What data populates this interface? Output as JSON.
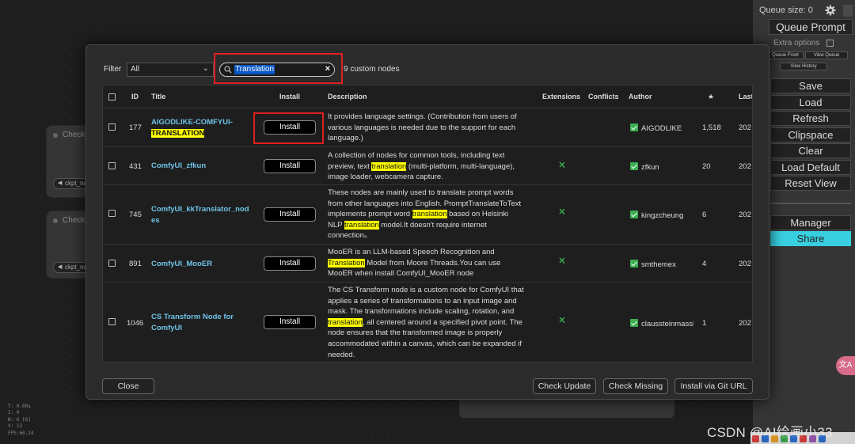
{
  "background": {
    "nodes": [
      {
        "title": "Checkp",
        "widget": "ckpt_na"
      },
      {
        "title": "Check",
        "widget": "ckpt_na"
      }
    ],
    "stats": [
      "T: 0.00s",
      "I: 0",
      "N: 6 [6]",
      "V: 12",
      "FPS:60.24"
    ]
  },
  "side_menu": {
    "queue_size": "Queue size: 0",
    "queue_prompt": "Queue Prompt",
    "extra_options": "Extra options",
    "queue_front": "Queue Front",
    "view_queue": "View Queue",
    "view_history": "View History",
    "buttons": [
      "Save",
      "Load",
      "Refresh",
      "Clipspace",
      "Clear",
      "Load Default",
      "Reset View"
    ],
    "manager": "Manager",
    "share": "Share",
    "share_color": "#38d0e0",
    "translate_bubble": "文A"
  },
  "dialog": {
    "filter_label": "Filter",
    "filter_value": "All",
    "search_value": "Translation",
    "result_count": "9 custom nodes",
    "columns": {
      "id": "ID",
      "title": "Title",
      "install": "Install",
      "description": "Description",
      "extensions": "Extensions",
      "conflicts": "Conflicts",
      "author": "Author",
      "stars": "★",
      "last": "Last"
    },
    "install_label": "Install",
    "rows": [
      {
        "id": "177",
        "title_a": "AIGODLIKE-COMFYUI-",
        "title_b": "TRANSLATION",
        "desc": [
          "It provides language settings. (Contribution from users of",
          "various languages is needed due to the support for each",
          "language.)"
        ],
        "author": "AIGODLIKE",
        "stars": "1,518",
        "last": "202"
      },
      {
        "id": "431",
        "title": "ComfyUI_zfkun",
        "desc_1": "A collection of nodes for common tools, including text",
        "desc_2a": "preview, text ",
        "desc_2hl": "translation",
        "desc_2b": " (multi-platform, multi-language),",
        "desc_3": "image loader, webcamera capture.",
        "author": "zfkun",
        "stars": "20",
        "last": "202"
      },
      {
        "id": "745",
        "title_a": "ComfyUI_kkTranslator_nod",
        "title_b": "es",
        "desc_1": "These nodes are mainly used to translate prompt words",
        "desc_2": "from other languages into English. PromptTranslateToText",
        "desc_3a": "implements prompt word ",
        "desc_3hl": "translation",
        "desc_3b": " based on Helsinki",
        "desc_4a": "NLP ",
        "desc_4hl": "translation",
        "desc_4b": " model.It doesn't require internet",
        "desc_5": "connection。",
        "author": "kingzcheung",
        "stars": "6",
        "last": "202"
      },
      {
        "id": "891",
        "title": "ComfyUI_MooER",
        "desc_1": "MooER is an LLM-based Speech Recognition and",
        "desc_2hl": "Translation",
        "desc_2b": " Model from Moore Threads.You can use",
        "desc_3": "MooER when install ComfyUI_MooER node",
        "author": "smthemex",
        "stars": "4",
        "last": "202"
      },
      {
        "id": "1046",
        "title_a": "CS Transform Node for",
        "title_b": "ComfyUI",
        "desc_1": "The CS Transform node is a custom node for ComfyUI that",
        "desc_2": "applies a series of transformations to an input image and",
        "desc_3": "mask. The transformations include scaling, rotation, and",
        "desc_4hl": "translation",
        "desc_4b": ", all centered around a specified pivot point. The",
        "desc_5": "node ensures that the transformed image is properly",
        "desc_6": "accommodated within a canvas, which can be expanded if",
        "desc_7": "needed.",
        "author": "claussteinmassl",
        "author_display": "claussteinmassl",
        "stars": "1",
        "last": "202"
      }
    ],
    "close": "Close",
    "check_update": "Check Update",
    "check_missing": "Check Missing",
    "install_git": "Install via Git URL"
  },
  "watermark": "CSDN @AI绘画小33"
}
